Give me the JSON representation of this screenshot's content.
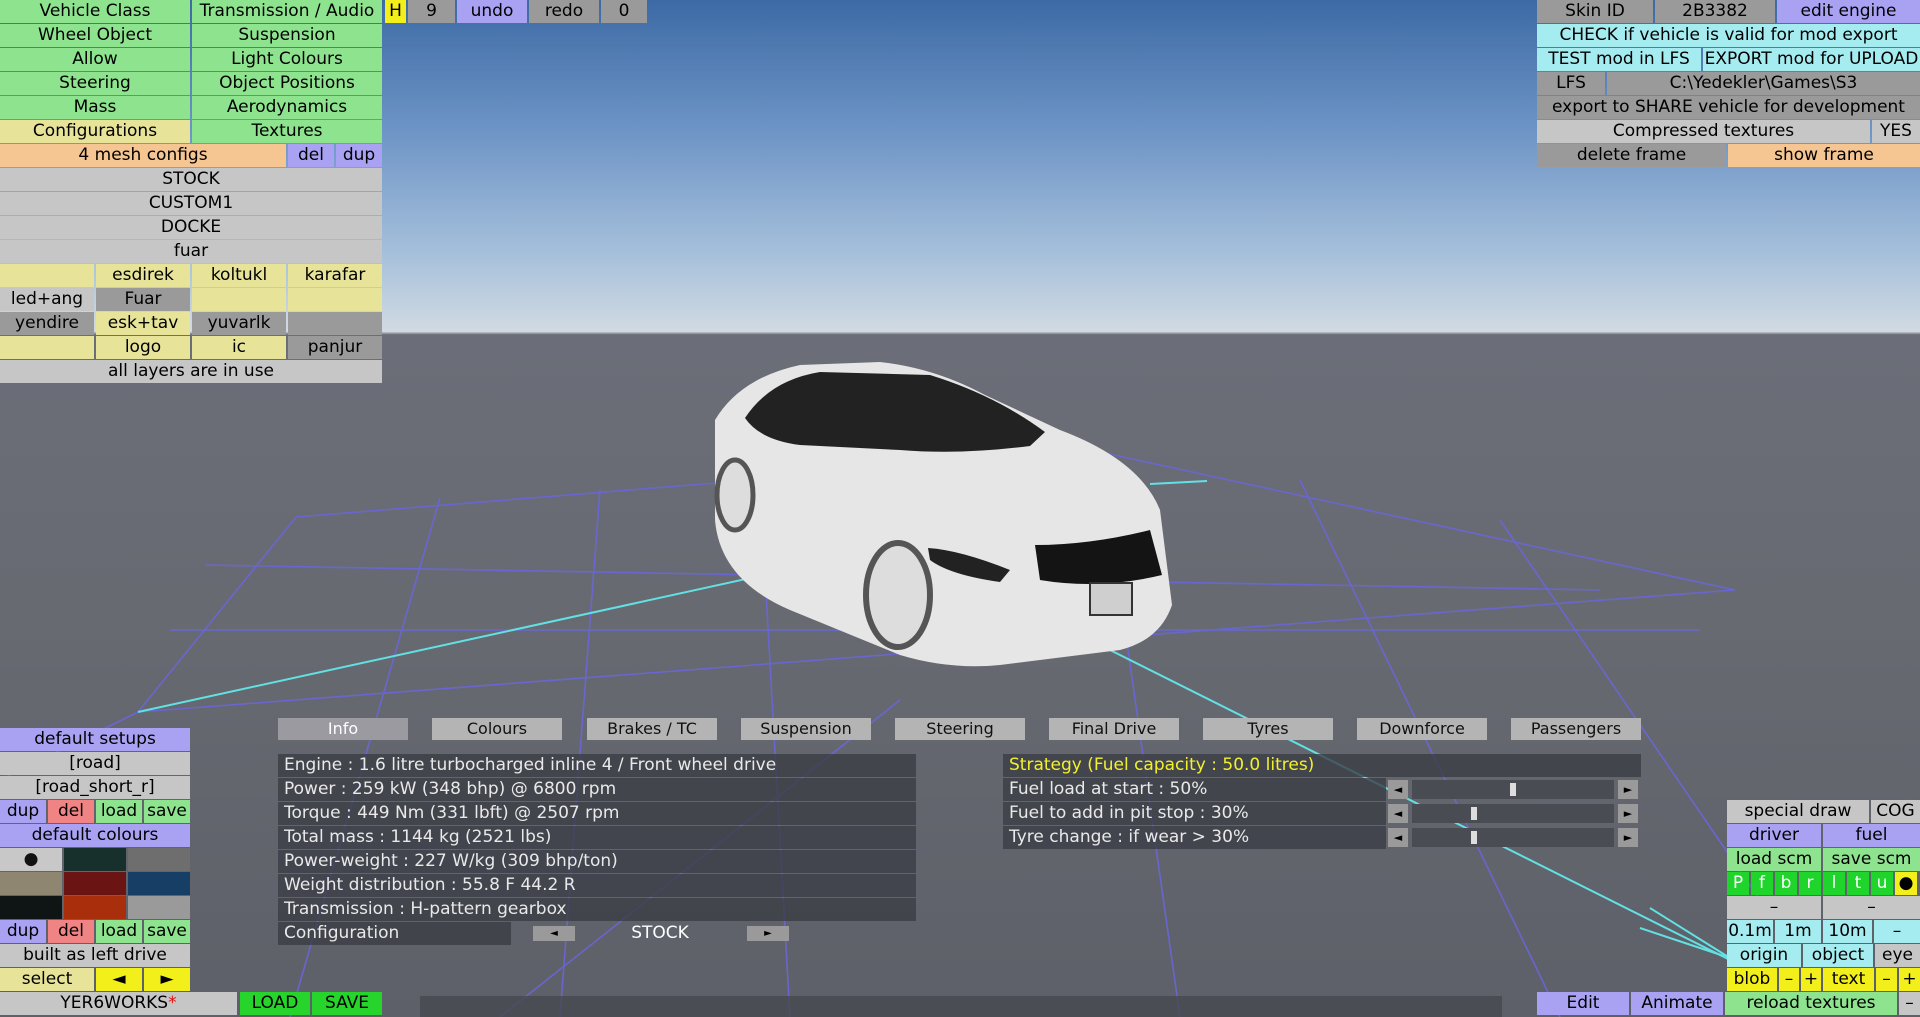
{
  "top_left_menu": {
    "vehicle_class": "Vehicle Class",
    "transmission_audio": "Transmission / Audio",
    "wheel_object": "Wheel Object",
    "suspension": "Suspension",
    "allow": "Allow",
    "light_colours": "Light Colours",
    "steering": "Steering",
    "object_positions": "Object Positions",
    "mass": "Mass",
    "aerodynamics": "Aerodynamics",
    "configurations": "Configurations",
    "textures": "Textures"
  },
  "top_toolbar": {
    "h": "H",
    "num": "9",
    "undo": "undo",
    "redo": "redo",
    "zero": "0"
  },
  "mesh_configs": {
    "label": "4 mesh configs",
    "del": "del",
    "dup": "dup",
    "items": [
      "STOCK",
      "CUSTOM1",
      "DOCKE",
      "fuar"
    ]
  },
  "layers": {
    "row1": [
      "",
      "esdirek",
      "koltukl",
      "karafar"
    ],
    "row2": [
      "led+ang",
      "Fuar",
      "",
      ""
    ],
    "row3": [
      "yendire",
      "esk+tav",
      "yuvarlk",
      ""
    ],
    "row4": [
      "",
      "logo",
      "ic",
      "panjur"
    ],
    "footer": "all layers are in use"
  },
  "top_right": {
    "skin_id_label": "Skin ID",
    "skin_id_value": "2B3382",
    "edit_engine": "edit engine",
    "check": "CHECK if vehicle is valid for mod export",
    "test": "TEST mod in LFS",
    "export": "EXPORT mod for UPLOAD",
    "lfs": "LFS",
    "path": "C:\\Yedekler\\Games\\S3",
    "share": "export to SHARE vehicle for development",
    "compressed": "Compressed textures",
    "yes": "YES",
    "delete_frame": "delete frame",
    "show_frame": "show frame"
  },
  "tabs": [
    "Info",
    "Colours",
    "Brakes / TC",
    "Suspension",
    "Steering",
    "Final Drive",
    "Tyres",
    "Downforce",
    "Passengers"
  ],
  "info": [
    "Engine : 1.6 litre turbocharged inline 4 / Front wheel drive",
    "Power : 259 kW (348 bhp) @ 6800 rpm",
    "Torque : 449 Nm (331 lbft) @ 2507 rpm",
    "Total mass : 1144 kg (2521 lbs)",
    "Power-weight : 227 W/kg (309 bhp/ton)",
    "Weight distribution : 55.8 F  44.2 R",
    "Transmission : H-pattern gearbox"
  ],
  "configuration": {
    "label": "Configuration",
    "value": "STOCK",
    "prev": "◄",
    "next": "►"
  },
  "strategy": {
    "title": "Strategy (Fuel capacity : 50.0 litres)",
    "rows": [
      {
        "label": "Fuel load at start : 50%",
        "value": 0.5
      },
      {
        "label": "Fuel to add in pit stop : 30%",
        "value": 0.3
      },
      {
        "label": "Tyre change : if wear > 30%",
        "value": 0.3
      }
    ],
    "left": "◄",
    "right": "►"
  },
  "bottom_left": {
    "default_setups": "default setups",
    "road": "[road]",
    "road_short": "[road_short_r]",
    "dup": "dup",
    "del": "del",
    "load": "load",
    "save": "save",
    "default_colours": "default colours",
    "colours": [
      "#c8c8c8",
      "#17302c",
      "#6e6e6e",
      "#8f8672",
      "#6a1414",
      "#173f66",
      "#0f1414",
      "#a82e0c",
      "#9a9a9a"
    ],
    "dot": "●",
    "dup2": "dup",
    "del2": "del",
    "load2": "load",
    "save2": "save",
    "left_drive": "built as left drive",
    "select": "select",
    "prev": "◄",
    "next": "►"
  },
  "bottom_bar": {
    "name": "YER6WORKS",
    "asterisk": "*",
    "load": "LOAD",
    "save": "SAVE",
    "edit": "Edit",
    "animate": "Animate",
    "reload": "reload textures",
    "minus": "–"
  },
  "bottom_right": {
    "special_draw": "special draw",
    "cog": "COG",
    "driver": "driver",
    "fuel": "fuel",
    "load_scm": "load scm",
    "save_scm": "save scm",
    "letters": [
      "P",
      "f",
      "b",
      "r",
      "l",
      "t",
      "u",
      "●"
    ],
    "dash1": "–",
    "dash2": "–",
    "d01": "0.1m",
    "d1": "1m",
    "d10": "10m",
    "dash3": "–",
    "origin": "origin",
    "object": "object",
    "eye": "eye",
    "blob": "blob",
    "m1": "–",
    "p1": "+",
    "text": "text",
    "m2": "–",
    "p2": "+"
  }
}
